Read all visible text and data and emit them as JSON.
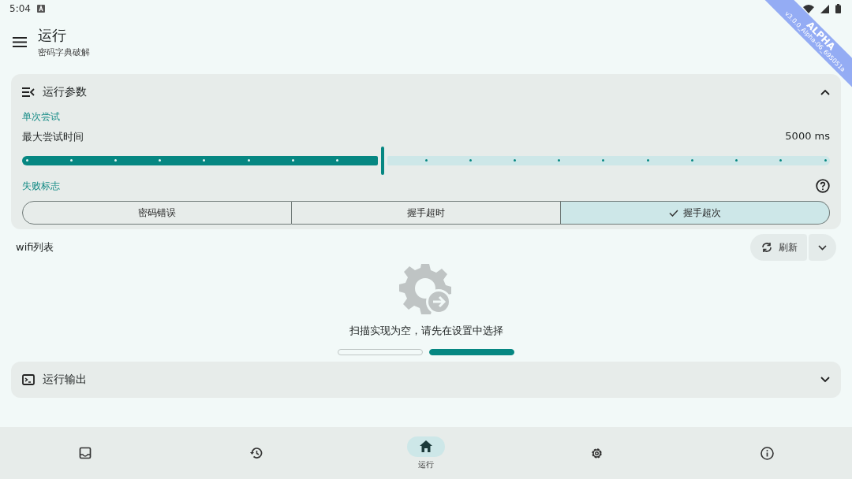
{
  "status_bar": {
    "time": "5:04"
  },
  "debug_banner": {
    "label": "ALPHA",
    "version": "v3.0.0_Alpha-06_695051a"
  },
  "app_bar": {
    "title": "运行",
    "subtitle": "密码字典破解"
  },
  "params_panel": {
    "title": "运行参数",
    "expanded": true,
    "section_single": "单次尝试",
    "slider": {
      "label": "最大尝试时间",
      "reading": "5000 ms",
      "level": 0.446
    },
    "section_fail": "失败标志",
    "segments": [
      {
        "label": "密码错误",
        "selected": false
      },
      {
        "label": "握手超时",
        "selected": false
      },
      {
        "label": "握手超次",
        "selected": true
      }
    ]
  },
  "wifi_list": {
    "title": "wifi列表",
    "refresh_label": "刷新",
    "empty_message": "扫描实现为空，请先在设置中选择",
    "pages": [
      {
        "selected": false
      },
      {
        "selected": true
      }
    ]
  },
  "output_panel": {
    "title": "运行输出",
    "expanded": false
  },
  "bottom_nav": [
    {
      "selected": false
    },
    {
      "selected": false
    },
    {
      "label": "运行",
      "selected": true
    },
    {
      "selected": false
    },
    {
      "selected": false
    }
  ]
}
